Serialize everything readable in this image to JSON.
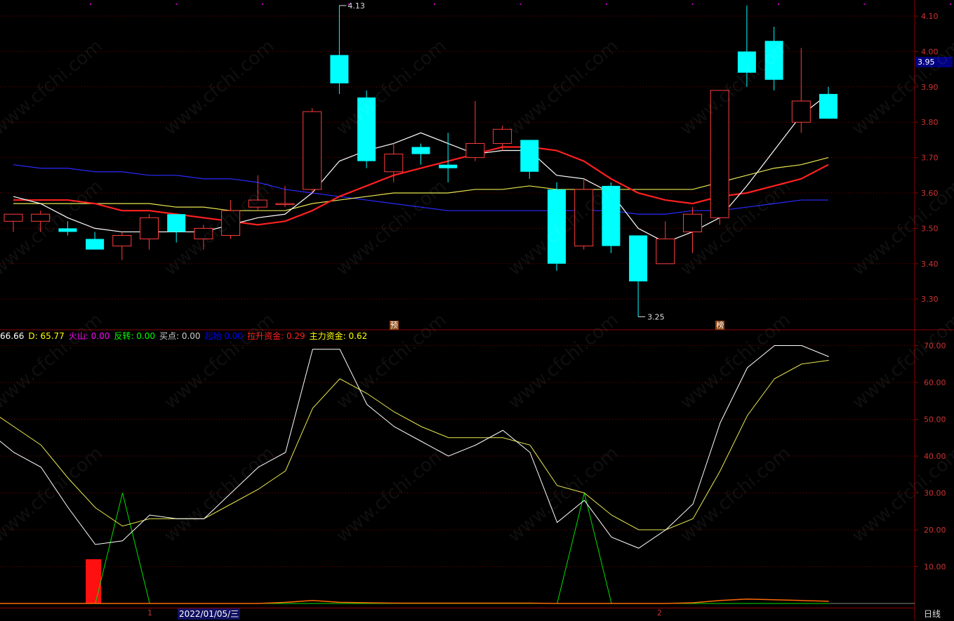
{
  "chart_data": [
    {
      "type": "candlestick",
      "yticks": [
        3.3,
        3.4,
        3.5,
        3.6,
        3.7,
        3.8,
        3.9,
        4.0,
        4.1
      ],
      "ylim": [
        3.22,
        4.15
      ],
      "candles": [
        {
          "o": 3.52,
          "h": 3.54,
          "l": 3.49,
          "c": 3.54
        },
        {
          "o": 3.52,
          "h": 3.55,
          "l": 3.49,
          "c": 3.54
        },
        {
          "o": 3.5,
          "h": 3.52,
          "l": 3.48,
          "c": 3.49
        },
        {
          "o": 3.47,
          "h": 3.49,
          "l": 3.44,
          "c": 3.44
        },
        {
          "o": 3.45,
          "h": 3.49,
          "l": 3.41,
          "c": 3.48
        },
        {
          "o": 3.47,
          "h": 3.54,
          "l": 3.44,
          "c": 3.53
        },
        {
          "o": 3.54,
          "h": 3.54,
          "l": 3.46,
          "c": 3.49
        },
        {
          "o": 3.47,
          "h": 3.51,
          "l": 3.44,
          "c": 3.5
        },
        {
          "o": 3.48,
          "h": 3.58,
          "l": 3.47,
          "c": 3.55
        },
        {
          "o": 3.56,
          "h": 3.65,
          "l": 3.55,
          "c": 3.58
        },
        {
          "o": 3.57,
          "h": 3.62,
          "l": 3.56,
          "c": 3.57
        },
        {
          "o": 3.61,
          "h": 3.84,
          "l": 3.6,
          "c": 3.83
        },
        {
          "o": 3.99,
          "h": 4.13,
          "l": 3.88,
          "c": 3.91
        },
        {
          "o": 3.87,
          "h": 3.89,
          "l": 3.67,
          "c": 3.69
        },
        {
          "o": 3.66,
          "h": 3.74,
          "l": 3.63,
          "c": 3.71
        },
        {
          "o": 3.73,
          "h": 3.74,
          "l": 3.68,
          "c": 3.71
        },
        {
          "o": 3.68,
          "h": 3.77,
          "l": 3.63,
          "c": 3.67
        },
        {
          "o": 3.7,
          "h": 3.86,
          "l": 3.69,
          "c": 3.74
        },
        {
          "o": 3.74,
          "h": 3.79,
          "l": 3.72,
          "c": 3.78
        },
        {
          "o": 3.75,
          "h": 3.75,
          "l": 3.64,
          "c": 3.66
        },
        {
          "o": 3.61,
          "h": 3.63,
          "l": 3.38,
          "c": 3.4
        },
        {
          "o": 3.45,
          "h": 3.64,
          "l": 3.44,
          "c": 3.61
        },
        {
          "o": 3.62,
          "h": 3.63,
          "l": 3.43,
          "c": 3.45
        },
        {
          "o": 3.48,
          "h": 3.48,
          "l": 3.25,
          "c": 3.35
        },
        {
          "o": 3.4,
          "h": 3.52,
          "l": 3.4,
          "c": 3.47
        },
        {
          "o": 3.49,
          "h": 3.56,
          "l": 3.43,
          "c": 3.54
        },
        {
          "o": 3.53,
          "h": 3.89,
          "l": 3.51,
          "c": 3.89
        },
        {
          "o": 4.0,
          "h": 4.13,
          "l": 3.9,
          "c": 3.94
        },
        {
          "o": 4.03,
          "h": 4.07,
          "l": 3.89,
          "c": 3.92
        },
        {
          "o": 3.8,
          "h": 4.01,
          "l": 3.77,
          "c": 3.86
        },
        {
          "o": 3.88,
          "h": 3.9,
          "l": 3.81,
          "c": 3.81
        }
      ],
      "ma_white": [
        3.59,
        3.57,
        3.53,
        3.5,
        3.49,
        3.49,
        3.49,
        3.49,
        3.51,
        3.53,
        3.54,
        3.6,
        3.69,
        3.72,
        3.74,
        3.77,
        3.74,
        3.71,
        3.72,
        3.72,
        3.65,
        3.64,
        3.6,
        3.5,
        3.46,
        3.49,
        3.53,
        3.62,
        3.72,
        3.82,
        3.88
      ],
      "ma_red": [
        3.58,
        3.58,
        3.58,
        3.57,
        3.55,
        3.55,
        3.54,
        3.53,
        3.52,
        3.51,
        3.52,
        3.55,
        3.59,
        3.62,
        3.65,
        3.67,
        3.69,
        3.71,
        3.73,
        3.73,
        3.72,
        3.69,
        3.64,
        3.6,
        3.58,
        3.57,
        3.59,
        3.6,
        3.62,
        3.64,
        3.68
      ],
      "ma_yellow": [
        3.57,
        3.57,
        3.57,
        3.57,
        3.57,
        3.57,
        3.56,
        3.56,
        3.55,
        3.55,
        3.55,
        3.57,
        3.58,
        3.59,
        3.6,
        3.6,
        3.6,
        3.61,
        3.61,
        3.62,
        3.61,
        3.61,
        3.61,
        3.61,
        3.61,
        3.61,
        3.63,
        3.65,
        3.67,
        3.68,
        3.7
      ],
      "ma_blue": [
        3.68,
        3.67,
        3.67,
        3.66,
        3.66,
        3.65,
        3.65,
        3.64,
        3.64,
        3.63,
        3.61,
        3.6,
        3.59,
        3.58,
        3.57,
        3.56,
        3.55,
        3.55,
        3.55,
        3.55,
        3.55,
        3.55,
        3.55,
        3.54,
        3.54,
        3.55,
        3.55,
        3.56,
        3.57,
        3.58,
        3.58
      ],
      "price_labels": {
        "high": "4.13",
        "low": "3.25"
      },
      "current_price": "3.95",
      "signals": [
        {
          "label": "预",
          "index": 14
        },
        {
          "label": "榜",
          "index": 26
        }
      ]
    },
    {
      "type": "line",
      "yticks": [
        10.0,
        20.0,
        30.0,
        40.0,
        50.0,
        60.0,
        70.0
      ],
      "ylim": [
        0,
        74
      ],
      "legend": [
        {
          "label": "66.66",
          "color": "#ffffff"
        },
        {
          "label": "D: 65.77",
          "color": "#ffff00"
        },
        {
          "label": "火山: 0.00",
          "color": "#ff00ff"
        },
        {
          "label": "反转: 0.00",
          "color": "#00ff00"
        },
        {
          "label": "买点: 0.00",
          "color": "#cccccc"
        },
        {
          "label": "起始 0.00",
          "color": "#0000ff"
        },
        {
          "label": "拉升资金: 0.29",
          "color": "#ff2020"
        },
        {
          "label": "主力资金: 0.62",
          "color": "#ffff00"
        }
      ],
      "k_series": [
        47,
        41,
        37,
        26,
        16,
        17,
        24,
        23,
        23,
        30,
        37,
        41,
        69,
        69,
        54,
        48,
        44,
        40,
        43,
        47,
        41,
        22,
        28,
        18,
        15,
        20,
        27,
        49,
        64,
        70,
        70,
        67
      ],
      "d_series": [
        53,
        48,
        43,
        34,
        26,
        21,
        23,
        23,
        23,
        27,
        31,
        36,
        53,
        61,
        57,
        52,
        48,
        45,
        45,
        45,
        43,
        32,
        30,
        24,
        20,
        20,
        23,
        36,
        51,
        61,
        65,
        66
      ],
      "reversal": [
        0,
        0,
        0,
        0,
        0,
        30,
        0,
        0,
        0,
        0,
        0,
        0,
        0,
        0,
        0,
        0,
        0,
        0,
        0,
        0,
        0,
        0,
        30,
        0,
        0,
        0,
        0,
        0,
        0,
        0,
        0,
        0
      ],
      "volcano_bar": {
        "index": 3,
        "value": 12
      },
      "capital_series": [
        0,
        0,
        0,
        0,
        0,
        0,
        0,
        0,
        0,
        0,
        0,
        0.3,
        0.8,
        0.3,
        0.2,
        0.1,
        0.1,
        0.1,
        0.1,
        0.1,
        0.1,
        0,
        0,
        0,
        0,
        0,
        0.2,
        0.8,
        1.2,
        1.0,
        0.8,
        0.6
      ]
    }
  ],
  "ui": {
    "date_label": "2022/01/05/三",
    "tick_marks": [
      "1",
      "2"
    ],
    "period": "日线",
    "watermark": "www.cfchi.com"
  },
  "colors": {
    "up": "#ff3c3c",
    "down": "#00ffff",
    "axis": "#8b0000",
    "grid": "#7a0000"
  }
}
